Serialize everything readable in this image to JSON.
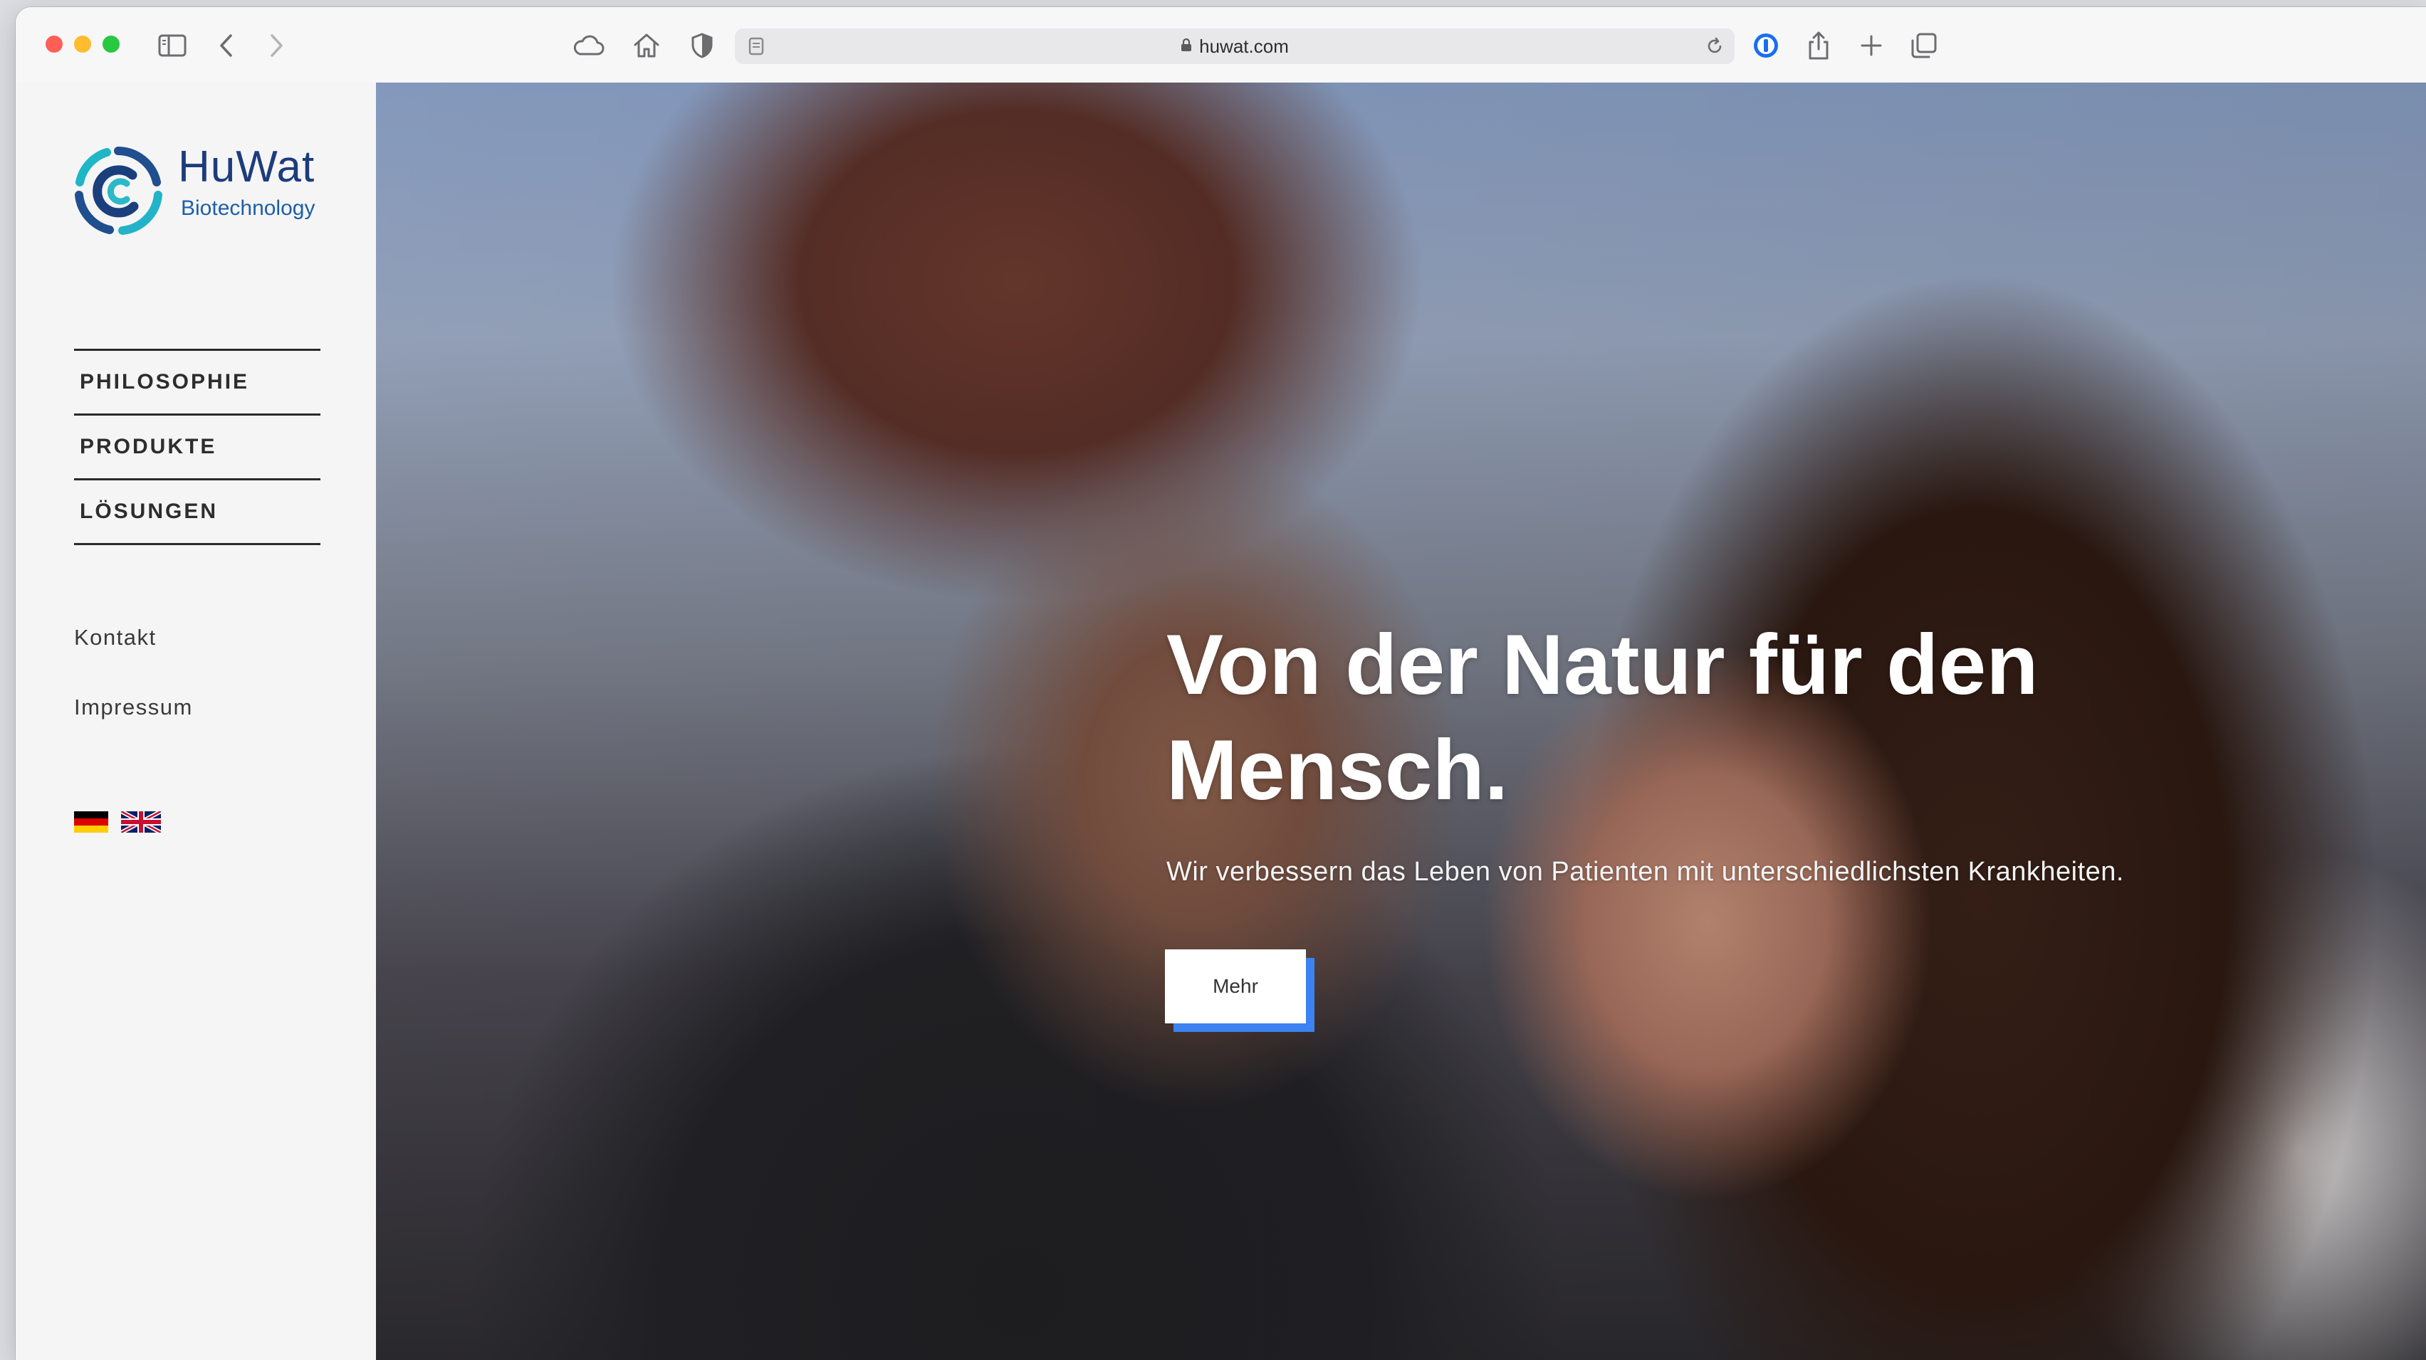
{
  "browser": {
    "url": "huwat.com",
    "traffic_lights": {
      "close": "#ff5f57",
      "minimize": "#febc2e",
      "maximize": "#28c840"
    },
    "icons": [
      "sidebar-icon",
      "back-icon",
      "forward-icon",
      "cloud-icon",
      "home-icon",
      "shield-icon",
      "reader-icon",
      "lock-icon",
      "reload-icon",
      "password-manager-icon",
      "share-icon",
      "new-tab-icon",
      "tabs-overview-icon"
    ]
  },
  "logo": {
    "name": "HuWat",
    "subtitle": "Biotechnology"
  },
  "nav": {
    "items": [
      {
        "label": "PHILOSOPHIE"
      },
      {
        "label": "PRODUKTE"
      },
      {
        "label": "LÖSUNGEN"
      }
    ]
  },
  "links": {
    "kontakt": "Kontakt",
    "impressum": "Impressum"
  },
  "languages": [
    "de-flag-icon",
    "uk-flag-icon"
  ],
  "hero": {
    "headline_line1": "Von der Natur für den",
    "headline_line2": "Mensch.",
    "subline": "Wir verbessern das Leben von Patienten mit unterschiedlichsten Krankheiten.",
    "button_label": "Mehr",
    "accent_color": "#3c82f0"
  }
}
